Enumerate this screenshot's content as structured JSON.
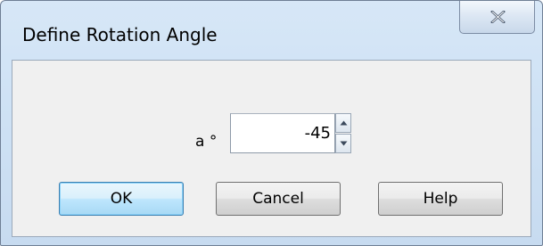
{
  "window": {
    "title": "Define Rotation Angle"
  },
  "titlebar": {
    "close_icon": "close-x-icon"
  },
  "form": {
    "angle_label": "a °",
    "angle_value": "-45",
    "spin_up_icon": "arrow-up-icon",
    "spin_down_icon": "arrow-down-icon"
  },
  "buttons": {
    "ok_label": "OK",
    "cancel_label": "Cancel",
    "help_label": "Help"
  },
  "colors": {
    "titlebar_bg": "#cfe2f5",
    "client_bg": "#f0f0f0",
    "default_button_border": "#3c7fb1"
  }
}
